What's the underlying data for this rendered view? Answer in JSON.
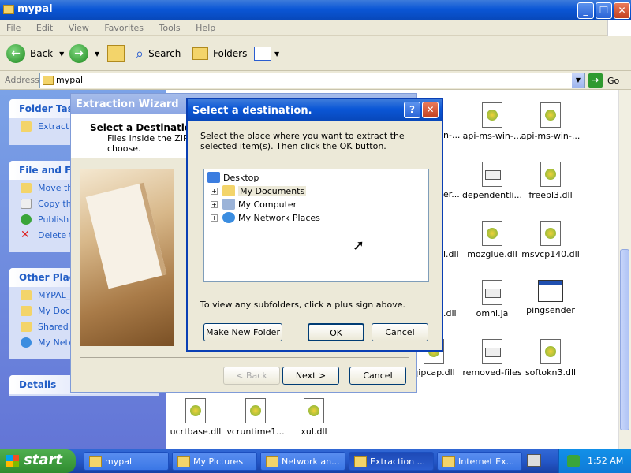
{
  "window": {
    "title": "mypal"
  },
  "menu": [
    "File",
    "Edit",
    "View",
    "Favorites",
    "Tools",
    "Help"
  ],
  "toolbar": {
    "back": "Back",
    "search": "Search",
    "folders": "Folders"
  },
  "address": {
    "label": "Address",
    "value": "mypal",
    "go": "Go"
  },
  "left_pane": {
    "folder_tasks": {
      "title": "Folder Task",
      "items": [
        "Extract"
      ]
    },
    "file_tasks": {
      "title": "File and Fol",
      "items": [
        "Move th",
        "Copy th",
        "Publish t",
        "Delete th"
      ]
    },
    "other_places": {
      "title": "Other Place",
      "items": [
        "MYPAL_",
        "My Docu",
        "Shared D",
        "My Netw"
      ]
    },
    "details": {
      "title": "Details"
    }
  },
  "files": [
    {
      "name": "api-ms-win-...",
      "icon": "dll-icon"
    },
    {
      "name": "api-ms-win-...",
      "icon": "dll-icon"
    },
    {
      "name": "dependentli...",
      "icon": "config-icon"
    },
    {
      "name": "freebl3.dll",
      "icon": "dll-icon"
    },
    {
      "name": "mozglue.dll",
      "icon": "dll-icon"
    },
    {
      "name": "msvcp140.dll",
      "icon": "dll-icon"
    },
    {
      "name": "omni.ja",
      "icon": "config-icon"
    },
    {
      "name": "pingsender",
      "icon": "exe-icon"
    },
    {
      "name": "removed-files",
      "icon": "config-icon"
    },
    {
      "name": "softokn3.dll",
      "icon": "dll-icon"
    },
    {
      "name": "ucrtbase.dll",
      "icon": "dll-icon"
    },
    {
      "name": "vcruntime1...",
      "icon": "dll-icon"
    },
    {
      "name": "xul.dll",
      "icon": "dll-icon"
    },
    {
      "name": "qipcap.dll",
      "icon": "dll-icon"
    }
  ],
  "partial_labels": [
    "n-...",
    "er...",
    "l.dll",
    ".dll"
  ],
  "wizard": {
    "title": "Extraction Wizard",
    "heading": "Select a Destination",
    "subtitle_1": "Files inside the ZIP ar",
    "subtitle_2": "choose.",
    "back": "< Back",
    "next": "Next >",
    "cancel": "Cancel"
  },
  "dialog": {
    "title": "Select a destination.",
    "help": "?",
    "close": "✕",
    "instruction": "Select the place where you want to extract the selected item(s).  Then click the OK button.",
    "tree": [
      {
        "label": "Desktop",
        "level": 0
      },
      {
        "label": "My Documents",
        "level": 1,
        "selected": true
      },
      {
        "label": "My Computer",
        "level": 1
      },
      {
        "label": "My Network Places",
        "level": 1
      }
    ],
    "hint": "To view any subfolders, click a plus sign above.",
    "new_folder": "Make New Folder",
    "ok": "OK",
    "cancel": "Cancel"
  },
  "taskbar": {
    "start": "start",
    "tasks": [
      "mypal",
      "My Pictures",
      "Network an...",
      "Extraction ...",
      "Internet Ex..."
    ],
    "clock": "1:52 AM"
  }
}
